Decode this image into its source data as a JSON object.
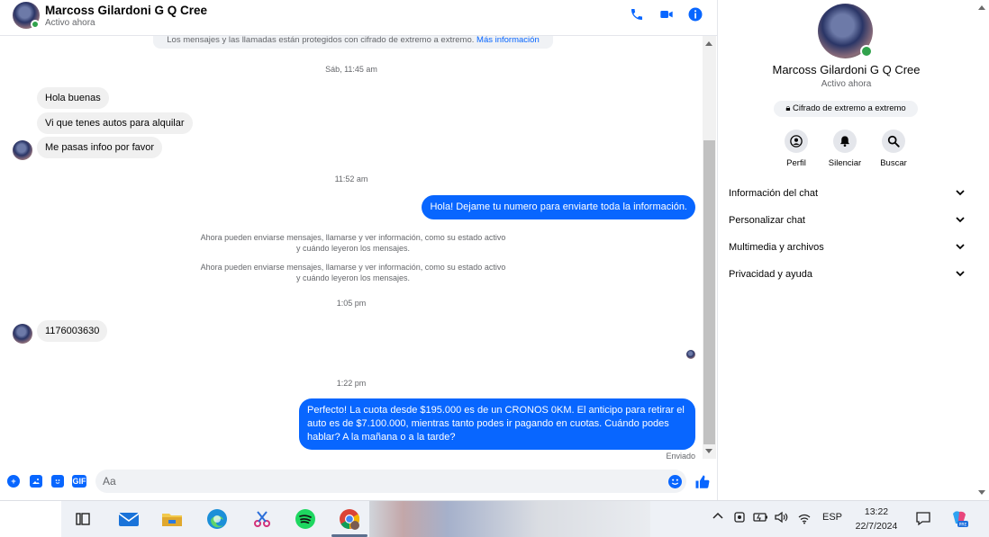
{
  "header": {
    "name": "Marcoss Gilardoni G Q Cree",
    "status": "Activo ahora",
    "icons": [
      "phone-icon",
      "video-icon",
      "info-icon"
    ]
  },
  "notice": {
    "text": "Los mensajes y las llamadas están protegidos con cifrado de extremo a extremo.",
    "link": "Más información"
  },
  "messages": {
    "time1": "Sáb, 11:45 am",
    "in1": "Hola buenas",
    "in2": "Vi que tenes autos para alquilar",
    "in3": "Me pasas infoo por favor",
    "time2": "11:52 am",
    "out1": "Hola! Dejame tu numero  para enviarte toda la información.",
    "note1": "Ahora pueden enviarse mensajes, llamarse y ver información, como su estado activo y cuándo leyeron los mensajes.",
    "note2": "Ahora pueden enviarse mensajes, llamarse y ver información, como su estado activo y cuándo leyeron los mensajes.",
    "time3": "1:05 pm",
    "in4": "1176003630",
    "time4": "1:22 pm",
    "out2": "Perfecto! La cuota desde $195.000 es de un CRONOS 0KM. El anticipo para retirar el auto es de $7.100.000, mientras tanto podes ir pagando en cuotas. Cuándo podes hablar? A la mañana o a la tarde?",
    "sent": "Enviado"
  },
  "composer": {
    "placeholder": "Aa",
    "gif_label": "GIF"
  },
  "info_panel": {
    "name": "Marcoss Gilardoni G Q Cree",
    "status": "Activo ahora",
    "badge": "Cifrado de extremo a extremo",
    "actions": [
      {
        "label": "Perfil",
        "icon": "profile-icon"
      },
      {
        "label": "Silenciar",
        "icon": "bell-icon"
      },
      {
        "label": "Buscar",
        "icon": "search-icon"
      }
    ],
    "rows": [
      {
        "label": "Información del chat"
      },
      {
        "label": "Personalizar chat"
      },
      {
        "label": "Multimedia y archivos"
      },
      {
        "label": "Privacidad y ayuda"
      }
    ]
  },
  "taskbar": {
    "lang": "ESP",
    "time": "13:22",
    "date": "22/7/2024"
  },
  "colors": {
    "accent": "#0866ff",
    "bubble_in": "#f0f0f0",
    "online": "#31a24c"
  }
}
